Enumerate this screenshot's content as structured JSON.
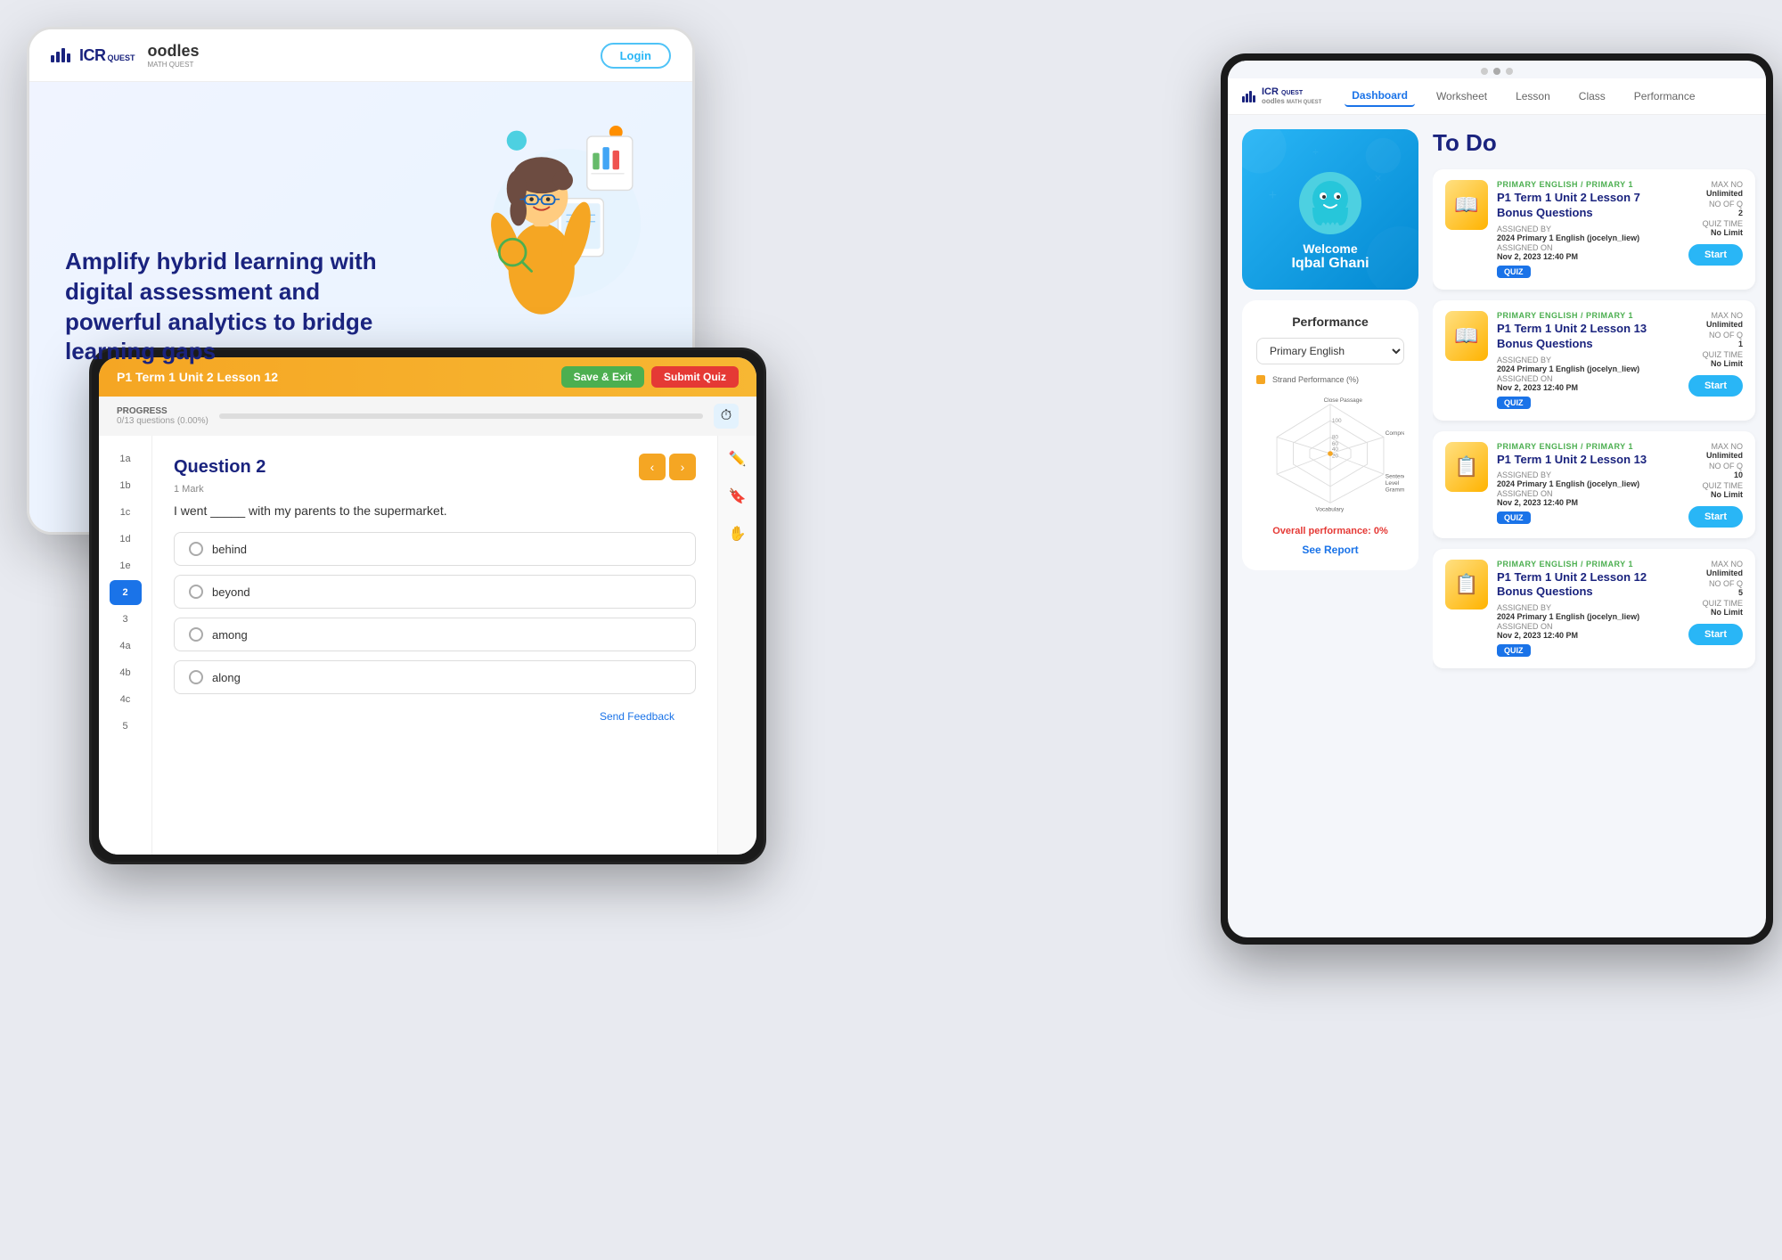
{
  "brand": {
    "name": "ICR Quest Oodles MathQuest",
    "icr": "ICR",
    "quest": "QUEST",
    "oodles": "oodles",
    "mathquest": "MATH QUEST"
  },
  "landing": {
    "login_label": "Login",
    "hero_title": "Amplify hybrid learning with digital assessment and powerful analytics to bridge learning gaps"
  },
  "quiz": {
    "header_title": "P1 Term 1 Unit 2 Lesson 12",
    "save_exit_label": "Save & Exit",
    "submit_quiz_label": "Submit Quiz",
    "progress_label": "PROGRESS",
    "progress_text": "0/13 questions (0.00%)",
    "question_num": "Question 2",
    "question_marks": "1 Mark",
    "question_text": "I went _____ with my parents to the supermarket.",
    "options": [
      "behind",
      "beyond",
      "among",
      "along"
    ],
    "feedback_label": "Send Feedback",
    "sidebar_items": [
      "1a",
      "1b",
      "1c",
      "1d",
      "1e",
      "2",
      "3",
      "4a",
      "4b",
      "4c",
      "5"
    ]
  },
  "dashboard": {
    "nav_items": [
      "Dashboard",
      "Worksheet",
      "Lesson",
      "Class",
      "Performance"
    ],
    "active_nav": "Dashboard",
    "welcome_text": "Welcome",
    "welcome_name": "Iqbal Ghani",
    "performance_title": "Performance",
    "performance_dropdown": "Primary English",
    "strand_label": "Strand Performance (%)",
    "overall_text": "Overall performance: 0%",
    "see_report_label": "See Report",
    "todo_title": "To Do",
    "todo_items": [
      {
        "subject": "PRIMARY ENGLISH / PRIMARY 1",
        "title": "P1 Term 1 Unit 2 Lesson 7 Bonus Questions",
        "assigned_by_label": "ASSIGNED BY",
        "assigned_by": "2024 Primary 1 English (jocelyn_liew)",
        "no_of_q_label": "NO OF Q",
        "no_of_q": "2",
        "assigned_on_label": "ASSIGNED ON",
        "assigned_on": "Nov 2, 2023 12:40 PM",
        "quiz_time_label": "QUIZ TIME",
        "quiz_time": "No Limit",
        "max_no_label": "MAX NO",
        "max_no": "Unlimited",
        "start_label": "Start"
      },
      {
        "subject": "PRIMARY ENGLISH / PRIMARY 1",
        "title": "P1 Term 1 Unit 2 Lesson 13 Bonus Questions",
        "assigned_by_label": "ASSIGNED BY",
        "assigned_by": "2024 Primary 1 English (jocelyn_liew)",
        "no_of_q_label": "NO OF Q",
        "no_of_q": "1",
        "assigned_on_label": "ASSIGNED ON",
        "assigned_on": "Nov 2, 2023 12:40 PM",
        "quiz_time_label": "QUIZ TIME",
        "quiz_time": "No Limit",
        "max_no_label": "MAX NO",
        "max_no": "Unlimited",
        "start_label": "Start"
      },
      {
        "subject": "PRIMARY ENGLISH / PRIMARY 1",
        "title": "P1 Term 1 Unit 2 Lesson 13",
        "assigned_by_label": "ASSIGNED BY",
        "assigned_by": "2024 Primary 1 English (jocelyn_liew)",
        "no_of_q_label": "NO OF Q",
        "no_of_q": "10",
        "assigned_on_label": "ASSIGNED ON",
        "assigned_on": "Nov 2, 2023 12:40 PM",
        "quiz_time_label": "QUIZ TIME",
        "quiz_time": "No Limit",
        "max_no_label": "MAX NO",
        "max_no": "Unlimited",
        "start_label": "Start"
      },
      {
        "subject": "PRIMARY ENGLISH / PRIMARY 1",
        "title": "P1 Term 1 Unit 2 Lesson 12 Bonus Questions",
        "assigned_by_label": "ASSIGNED BY",
        "assigned_by": "2024 Primary 1 English (jocelyn_liew)",
        "no_of_q_label": "NO OF Q",
        "no_of_q": "5",
        "assigned_on_label": "ASSIGNED ON",
        "assigned_on": "Nov 2, 2023 12:40 PM",
        "quiz_time_label": "QUIZ TIME",
        "quiz_time": "No Limit",
        "max_no_label": "MAX NO",
        "max_no": "Unlimited",
        "start_label": "Start"
      }
    ]
  }
}
